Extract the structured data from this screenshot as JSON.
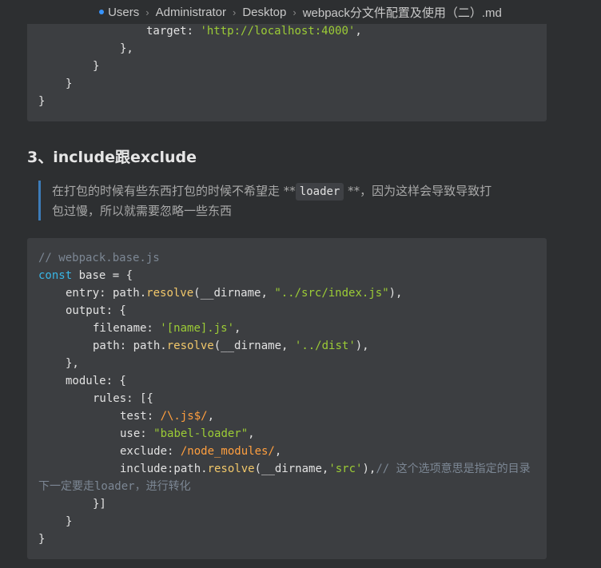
{
  "breadcrumb": {
    "items": [
      "Users",
      "Administrator",
      "Desktop",
      "webpack分文件配置及使用（二）.md"
    ]
  },
  "top_code": {
    "l1": "target: ",
    "l1_str": "'http://localhost:4000'",
    "l1_end": ",",
    "l2": "},",
    "l3": "}",
    "l4": "}",
    "l5": "}"
  },
  "section": {
    "heading": "3、include跟exclude"
  },
  "quote": {
    "part1": "在打包的时候有些东西打包的时候不希望走 **",
    "code": "loader",
    "part2": " **，因为这样会导致导致打",
    "line2": "包过慢，所以就需要忽略一些东西"
  },
  "main_code": {
    "comment": "// webpack.base.js",
    "const_kw": "const",
    "base_decl": " base = {",
    "entry_key": "entry: path.",
    "resolve": "resolve",
    "entry_args": "(__dirname, ",
    "entry_str": "\"../src/index.js\"",
    "close_paren_comma": "),",
    "output_open": "output: {",
    "filename_key": "filename: ",
    "filename_str": "'[name].js'",
    "comma": ",",
    "path_key": "path: path.",
    "path_args": "(__dirname, ",
    "path_str": "'../dist'",
    "close_brace_comma": "},",
    "module_open": "module: {",
    "rules_open": "rules: [{",
    "test_key": "test: ",
    "test_re": "/\\.js$/",
    "use_key": "use: ",
    "use_str": "\"babel-loader\"",
    "exclude_key": "exclude: ",
    "exclude_re": "/node_modules/",
    "include_key": "include:path.",
    "include_args": "(__dirname,",
    "include_str": "'src'",
    "include_end": "),",
    "include_comment": "// 这个选项意思是指定的目录",
    "include_comment2": "下一定要走loader，进行转化",
    "rules_close": "}]",
    "module_close": "}",
    "base_close": "}"
  }
}
